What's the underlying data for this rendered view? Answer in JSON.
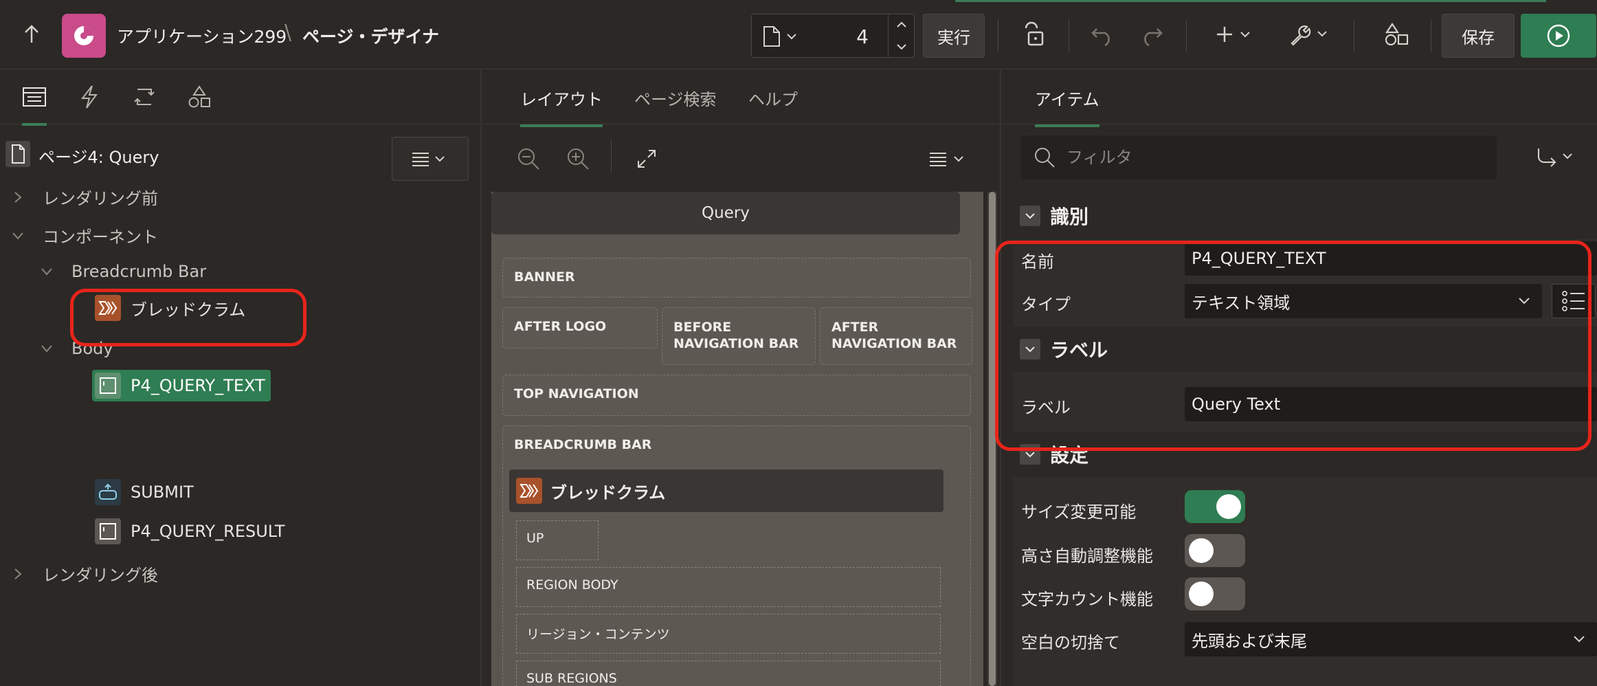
{
  "header": {
    "app_title": "アプリケーション299",
    "separator": "\\",
    "page_title": "ページ・デザイナ",
    "page_number": "4",
    "run_small_label": "実行",
    "save_label": "保存"
  },
  "left": {
    "tabs": [
      "rendering-tab",
      "dynamic-actions-tab",
      "processing-tab",
      "shared-components-tab"
    ],
    "root_label": "ページ4: Query",
    "tree": {
      "before_rendering": "レンダリング前",
      "components": "コンポーネント",
      "breadcrumb_bar": "Breadcrumb Bar",
      "breadcrumb": "ブレッドクラム",
      "body": "Body",
      "p4_query_text": "P4_QUERY_TEXT",
      "submit": "SUBMIT",
      "p4_query_result": "P4_QUERY_RESULT",
      "after_rendering": "レンダリング後"
    }
  },
  "center": {
    "tabs": [
      "レイアウト",
      "ページ検索",
      "ヘルプ"
    ],
    "regions": {
      "query": "Query",
      "banner": "BANNER",
      "after_logo": "AFTER LOGO",
      "before_nav": "BEFORE NAVIGATION BAR",
      "after_nav": "AFTER NAVIGATION BAR",
      "top_nav": "TOP NAVIGATION",
      "breadcrumb_bar": "BREADCRUMB BAR",
      "breadcrumb": "ブレッドクラム",
      "up": "UP",
      "region_body": "REGION BODY",
      "region_contents": "リージョン・コンテンツ",
      "sub_regions": "SUB REGIONS"
    }
  },
  "right": {
    "tab": "アイテム",
    "filter_placeholder": "フィルタ",
    "groups": {
      "identification": "識別",
      "label": "ラベル",
      "settings": "設定"
    },
    "props": {
      "name_label": "名前",
      "name_value": "P4_QUERY_TEXT",
      "type_label": "タイプ",
      "type_value": "テキスト領域",
      "label_label": "ラベル",
      "label_value": "Query Text",
      "resizable_label": "サイズ変更可能",
      "auto_height_label": "高さ自動調整機能",
      "char_count_label": "文字カウント機能",
      "trim_label": "空白の切捨て",
      "trim_value": "先頭および末尾"
    },
    "toggles": {
      "resizable": true,
      "auto_height": false,
      "char_count": false
    }
  },
  "colors": {
    "accent_green": "#2f7d52",
    "highlight_red": "#e8241b",
    "app_icon": "#c94b8a"
  }
}
